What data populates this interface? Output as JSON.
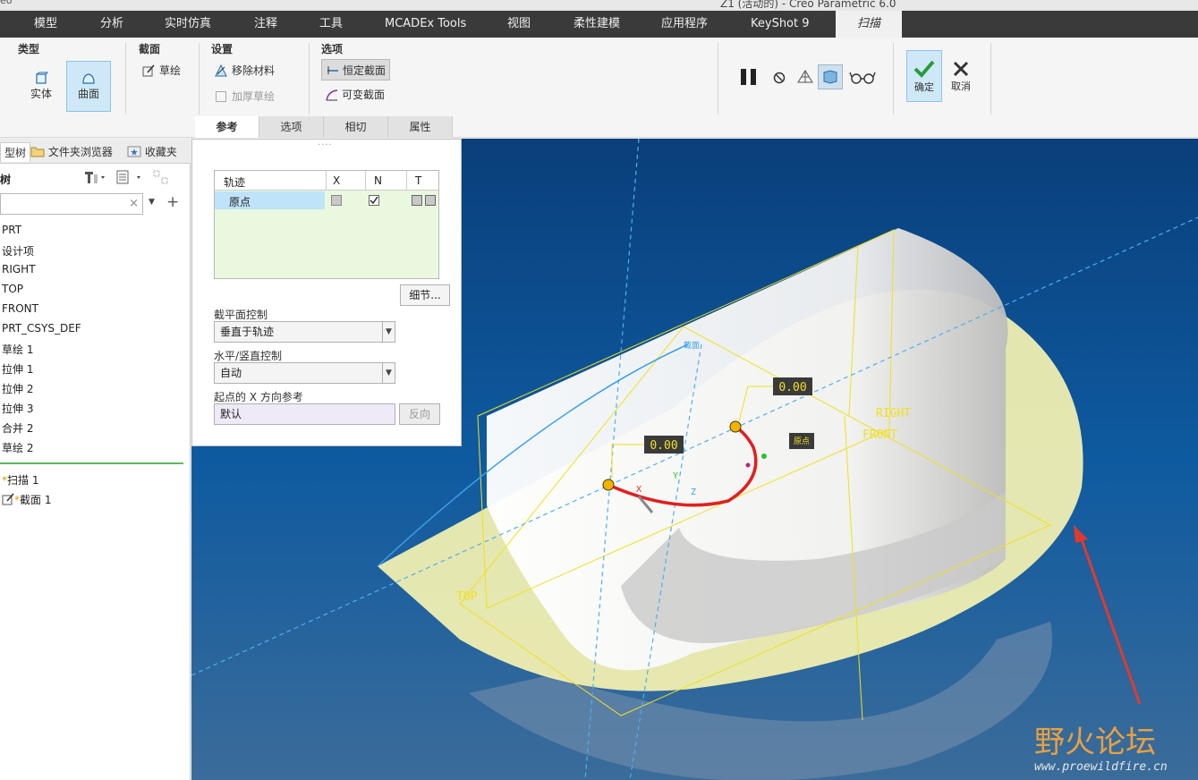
{
  "window": {
    "title": "Z1 (活动的) - Creo Parametric 6.0",
    "app_prefix": "eo"
  },
  "tabs": [
    {
      "label": "模型"
    },
    {
      "label": "分析"
    },
    {
      "label": "实时仿真"
    },
    {
      "label": "注释"
    },
    {
      "label": "工具"
    },
    {
      "label": "MCADEx Tools"
    },
    {
      "label": "视图"
    },
    {
      "label": "柔性建模"
    },
    {
      "label": "应用程序"
    },
    {
      "label": "KeyShot 9"
    },
    {
      "label": "扫描"
    }
  ],
  "ribbon": {
    "type_group": {
      "title": "类型",
      "solid": "实体",
      "surface": "曲面"
    },
    "section_group": {
      "title": "截面",
      "sketch": "草绘"
    },
    "settings_group": {
      "title": "设置",
      "remove_material": "移除材料",
      "thicken_sketch": "加厚草绘"
    },
    "options_group": {
      "title": "选项",
      "constant_section": "恒定截面",
      "variable_section": "可变截面"
    },
    "ok": "确定",
    "cancel": "取消"
  },
  "subtabs": [
    {
      "label": "参考"
    },
    {
      "label": "选项"
    },
    {
      "label": "相切"
    },
    {
      "label": "属性"
    }
  ],
  "left_panel": {
    "tabs": {
      "model_tree": "型树",
      "folder_browser": "文件夹浏览器",
      "favorites": "收藏夹"
    },
    "header": "树",
    "items": [
      {
        "label": "PRT"
      },
      {
        "label": "设计项"
      },
      {
        "label": "RIGHT"
      },
      {
        "label": "TOP"
      },
      {
        "label": "FRONT"
      },
      {
        "label": "PRT_CSYS_DEF"
      },
      {
        "label": "草绘 1"
      },
      {
        "label": "拉伸 1"
      },
      {
        "label": "拉伸 2"
      },
      {
        "label": "拉伸 3"
      },
      {
        "label": "合并 2"
      },
      {
        "label": "草绘 2"
      }
    ],
    "active_items": [
      {
        "label": "扫描 1"
      },
      {
        "label": "截面 1"
      }
    ]
  },
  "references_panel": {
    "columns": [
      "轨迹",
      "X",
      "N",
      "T"
    ],
    "rows": [
      {
        "name": "原点"
      }
    ],
    "details_button": "细节...",
    "section_plane_label": "截平面控制",
    "section_plane_value": "垂直于轨迹",
    "hv_label": "水平/竖直控制",
    "hv_value": "自动",
    "x_ref_label": "起点的 X 方向参考",
    "x_ref_value": "默认",
    "flip_button": "反向"
  },
  "viewport": {
    "dim_left": "0.00",
    "dim_right": "0.00",
    "origin_label": "原点",
    "section_label": "截面",
    "right_label": "RIGHT",
    "front_label": "FRONT",
    "top_label": "TOP",
    "axis_x": "X",
    "axis_y": "Y",
    "axis_z": "Z",
    "watermark_cn": "野火论坛",
    "watermark_url": "www.proewildfire.cn"
  },
  "colors": {
    "accent": "#1d8fd0",
    "viewport_bg": "#0c4d8a",
    "trajectory": "#e02020",
    "datum": "#f0e020"
  }
}
